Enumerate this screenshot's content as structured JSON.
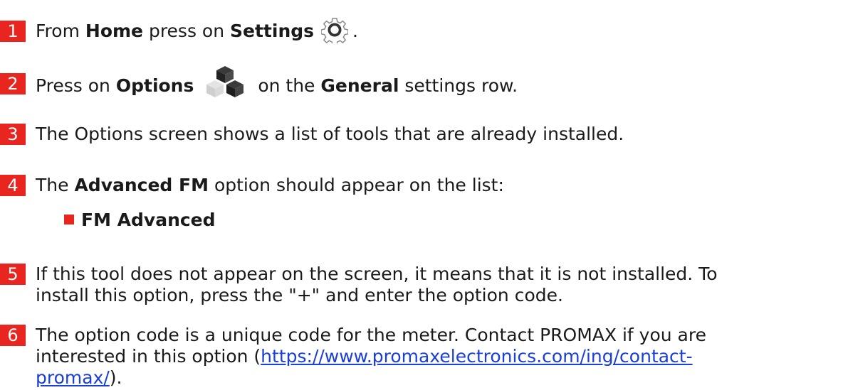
{
  "steps": [
    {
      "num": "1",
      "t1": "From ",
      "b1": "Home",
      "t2": " press on ",
      "b2": "Settings",
      "t3": "."
    },
    {
      "num": "2",
      "t1": "Press on ",
      "b1": "Options",
      "t2": " on the ",
      "b2": "General",
      "t3": " settings row."
    },
    {
      "num": "3",
      "text": "The Options screen shows a list of tools that are already installed."
    },
    {
      "num": "4",
      "t1": "The ",
      "b1": "Advanced FM",
      "t2": " option should appear on the list:"
    },
    {
      "num": "5",
      "line1": "If this tool does not appear on the screen, it means that it is not installed. To",
      "line2": "install this option, press the \"+\" and enter the option code."
    },
    {
      "num": "6",
      "line1_pre": "The option code is a unique code for the meter. Contact PROMAX if you are",
      "line2_pre": "interested in this option (",
      "link_part1": "https://www.promaxelectronics.com/ing/contact-",
      "link_part2": "promax/",
      "line3_post": ")."
    }
  ],
  "bullet": {
    "label": "FM Advanced"
  },
  "icons": {
    "settings": "gear-icon",
    "options": "cubes-icon"
  },
  "colors": {
    "accent": "#e8251e",
    "link": "#1a3fd6",
    "text": "#1a1a1a"
  }
}
